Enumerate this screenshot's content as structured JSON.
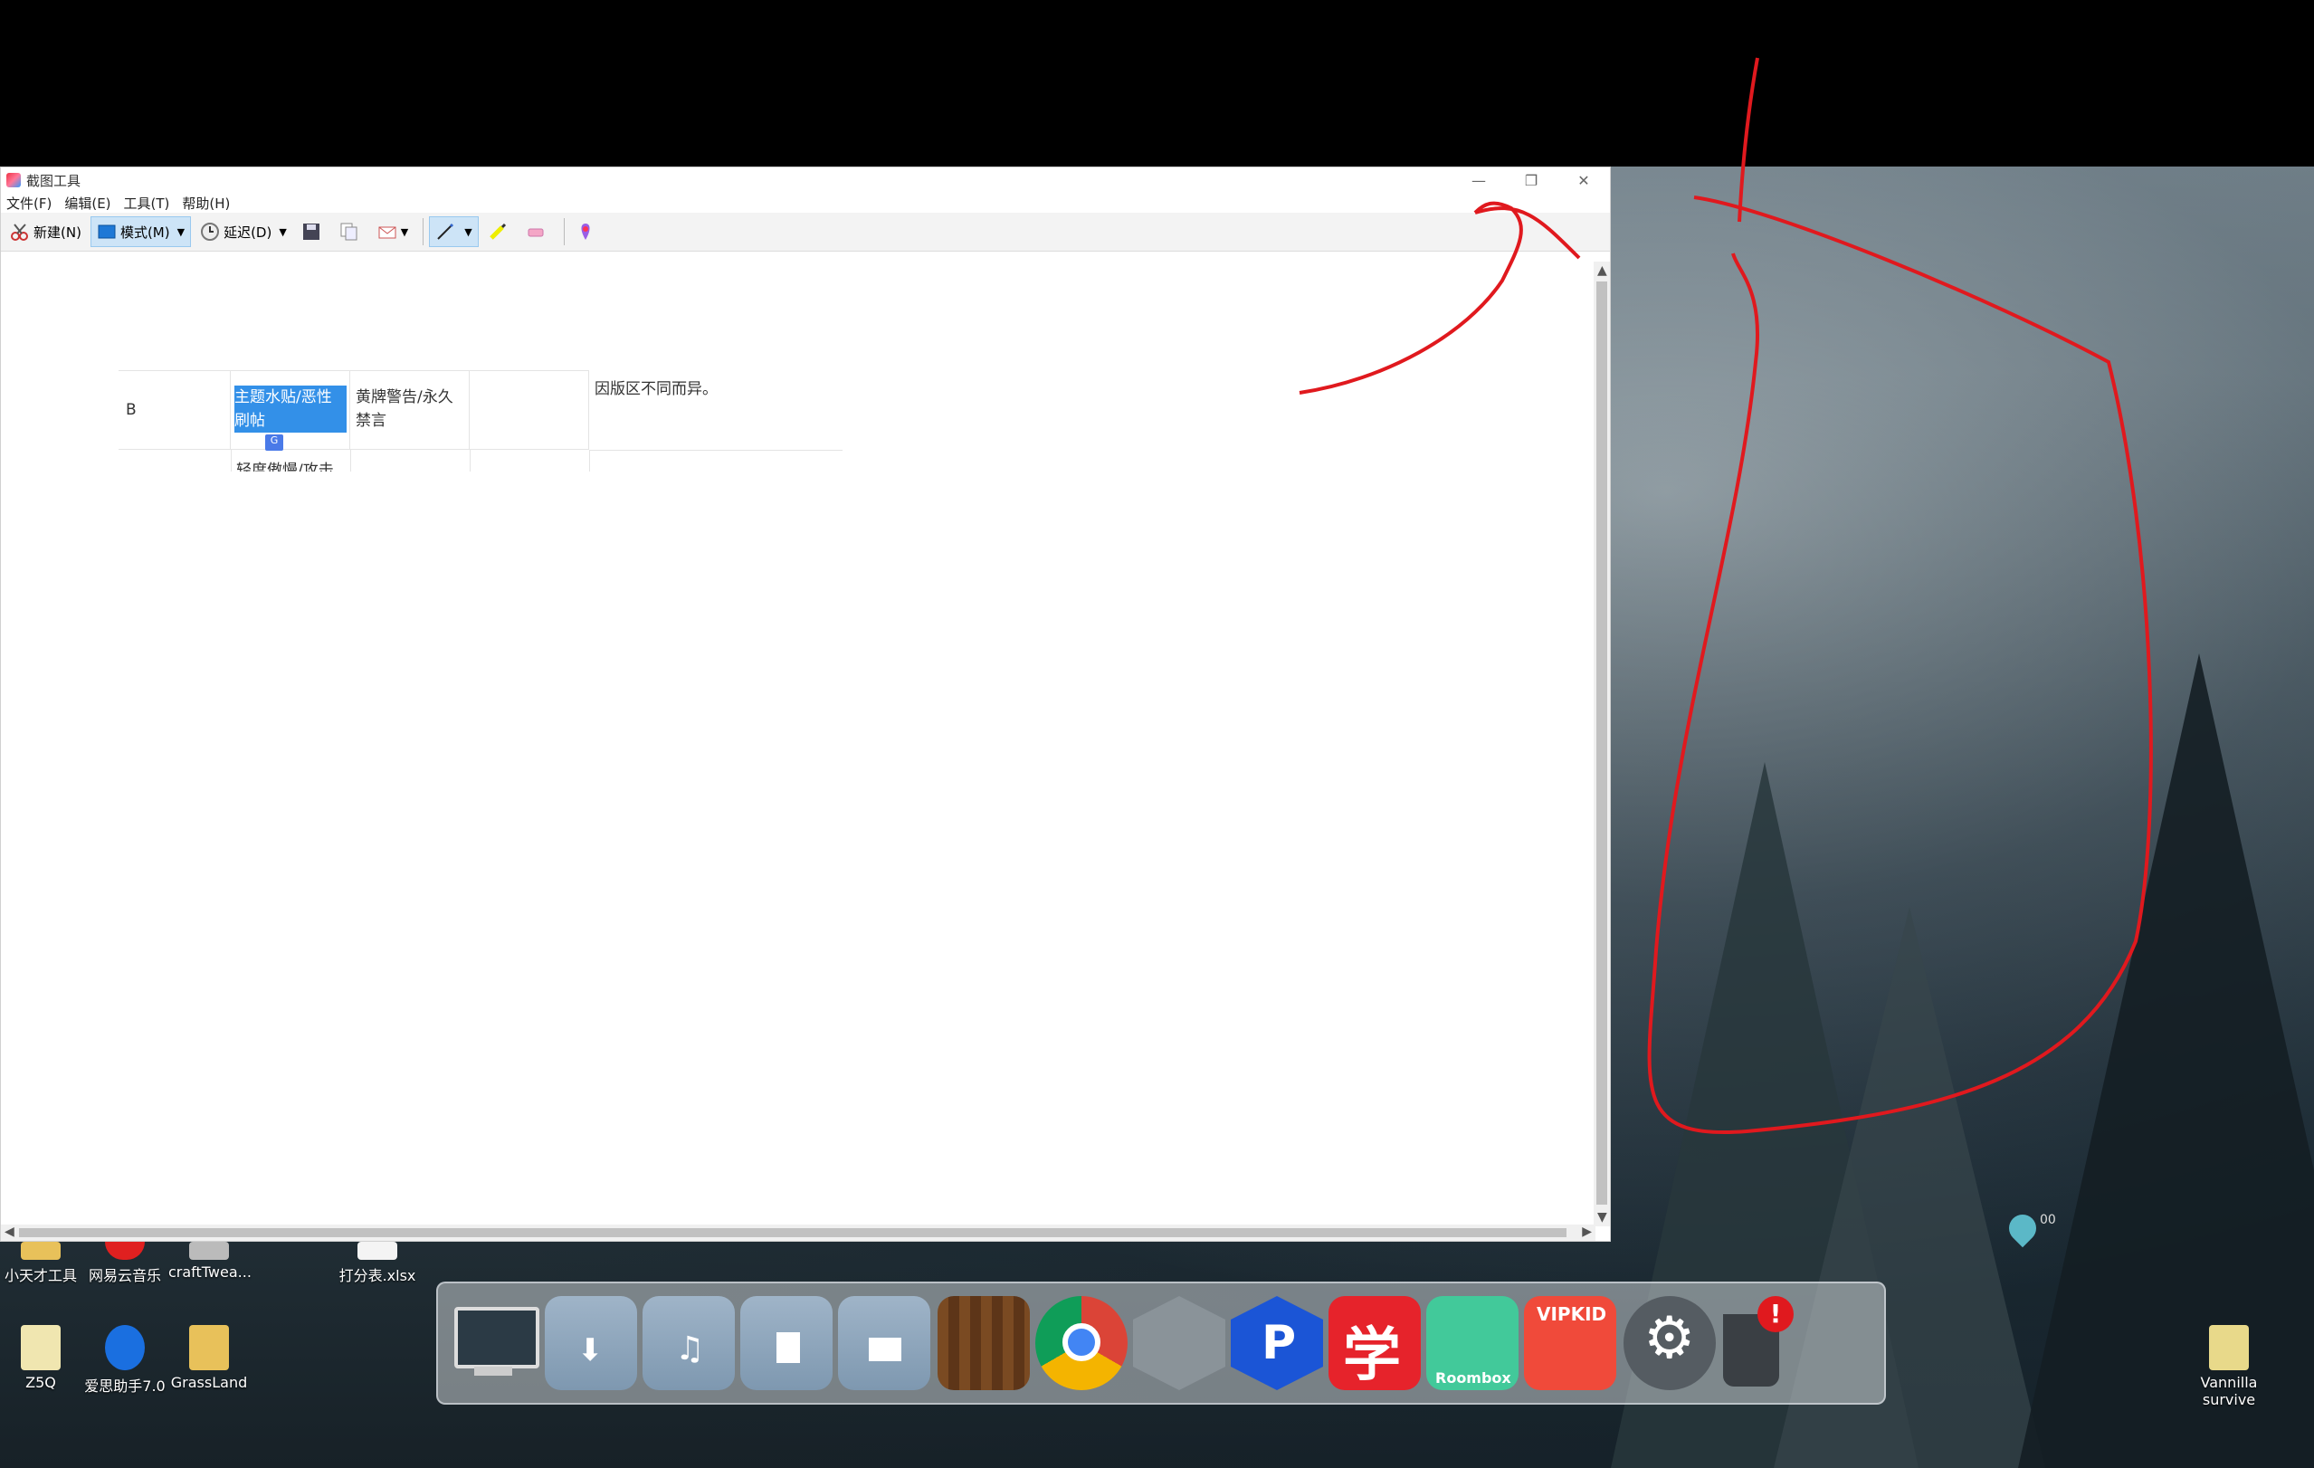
{
  "window": {
    "title": "截图工具",
    "controls": {
      "minimize": "—",
      "restore": "❐",
      "close": "✕"
    }
  },
  "menu": [
    "文件(F)",
    "编辑(E)",
    "工具(T)",
    "帮助(H)"
  ],
  "toolbar": {
    "new_label": "新建(N)",
    "mode_label": "模式(M)",
    "delay_label": "延迟(D)"
  },
  "snip": {
    "col_b": "B",
    "cell_topic": "主题水贴/恶性刷帖",
    "cell_penalty": "黄牌警告/永久禁言",
    "cell_note": "因版区不同而异。",
    "cell_partial": "轻度傲慢/攻击"
  },
  "desktop": {
    "icons_row1": [
      "小天才工具",
      "网易云音乐",
      "craftTwea...",
      "打分表.xlsx"
    ],
    "icons_row2": [
      "Z5Q",
      "爱思助手7.0",
      "GrassLand"
    ],
    "icon_right": "Vannilla survive",
    "badge_text": "00"
  },
  "dock": {
    "roombox_label": "Roombox",
    "xue_label": "学",
    "vipkid_label": "VIPKID",
    "trash_badge": "!"
  },
  "colors": {
    "annotation_red": "#e0191e",
    "selection_blue": "#3390e8"
  }
}
